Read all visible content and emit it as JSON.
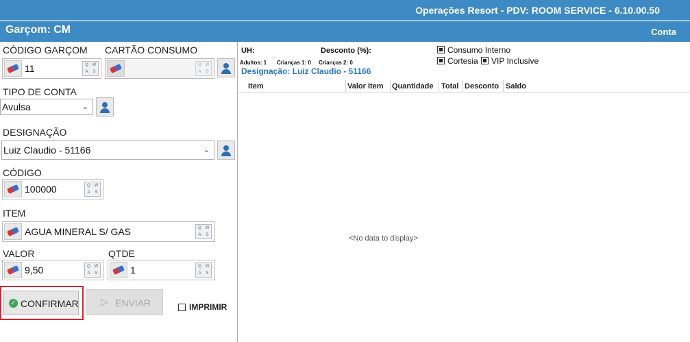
{
  "window": {
    "title": "Operações Resort - PDV: ROOM SERVICE - 6.10.00.50"
  },
  "header": {
    "waiter": "Garçom: CM",
    "account_link": "Conta"
  },
  "form": {
    "waiter_code": {
      "label": "CÓDIGO GARÇOM",
      "value": "11"
    },
    "consumption_card": {
      "label": "CARTÃO CONSUMO",
      "value": ""
    },
    "account_type": {
      "label": "TIPO DE CONTA",
      "value": "Avulsa"
    },
    "designation": {
      "label": "DESIGNAÇÃO",
      "value": "Luiz  Claudio - 51166"
    },
    "code": {
      "label": "CÓDIGO",
      "value": "100000"
    },
    "item": {
      "label": "ITEM",
      "value": "AGUA MINERAL S/ GAS"
    },
    "price": {
      "label": "VALOR",
      "value": "9,50"
    },
    "qty": {
      "label": "QTDE",
      "value": "1"
    },
    "keypad": [
      "Q",
      "W",
      "A",
      "S"
    ]
  },
  "actions": {
    "confirm": "CONFIRMAR",
    "send": "ENVIAR",
    "print": "IMPRIMIR"
  },
  "info": {
    "uh_label": "UH:",
    "discount_label": "Desconto (%):",
    "adults": "Adultos: 1",
    "children1": "Crianças 1: 0",
    "children2": "Crianças 2: 0",
    "designation": "Designação: Luiz  Claudio - 51166",
    "checks": {
      "internal": "Consumo Interno",
      "courtesy": "Cortesia",
      "vip": "VIP Inclusive"
    }
  },
  "grid": {
    "columns": [
      "Item",
      "Valor Item",
      "Quantidade",
      "Total",
      "Desconto",
      "Saldo"
    ],
    "empty_text": "<No data to display>"
  },
  "colors": {
    "accent": "#3d8ac4",
    "highlight": "#d9232d",
    "confirm_icon": "#3aa655"
  }
}
